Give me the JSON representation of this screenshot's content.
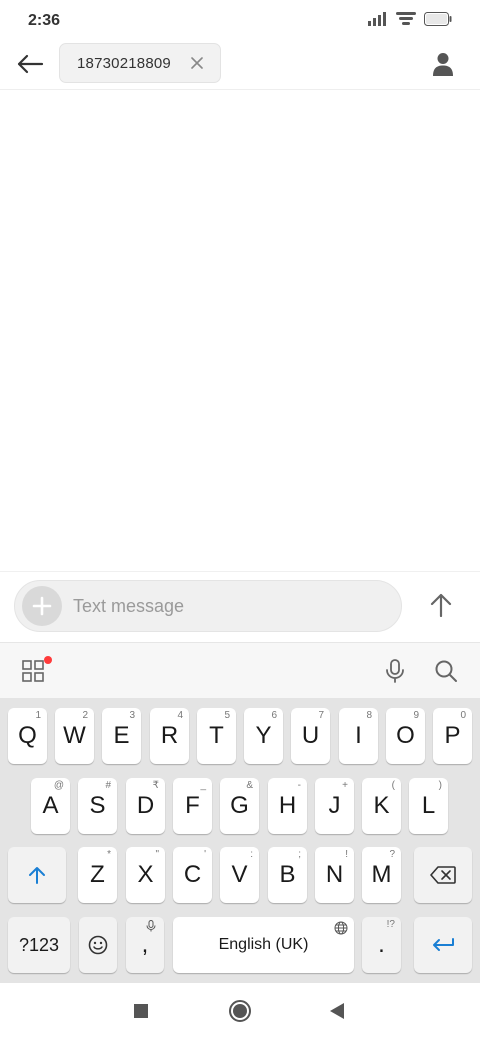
{
  "status_bar": {
    "time": "2:36",
    "icons": [
      "signal-icon",
      "wifi-icon",
      "battery-icon"
    ]
  },
  "header": {
    "back_icon": "arrow-left-icon",
    "recipient": "18730218809",
    "chip_close_icon": "close-icon",
    "contact_icon": "person-icon"
  },
  "compose": {
    "placeholder": "Text message",
    "attach_icon": "plus-icon",
    "send_icon": "arrow-up-icon"
  },
  "keyboard_toolbar": {
    "icons": [
      "apps-grid-icon",
      "mic-icon",
      "search-icon"
    ],
    "notification_color": "#ff3b3b"
  },
  "keyboard": {
    "row1": [
      {
        "label": "Q",
        "hint": "1"
      },
      {
        "label": "W",
        "hint": "2"
      },
      {
        "label": "E",
        "hint": "3"
      },
      {
        "label": "R",
        "hint": "4"
      },
      {
        "label": "T",
        "hint": "5"
      },
      {
        "label": "Y",
        "hint": "6"
      },
      {
        "label": "U",
        "hint": "7"
      },
      {
        "label": "I",
        "hint": "8"
      },
      {
        "label": "O",
        "hint": "9"
      },
      {
        "label": "P",
        "hint": "0"
      }
    ],
    "row2": [
      {
        "label": "A",
        "hint": "@"
      },
      {
        "label": "S",
        "hint": "#"
      },
      {
        "label": "D",
        "hint": "₹"
      },
      {
        "label": "F",
        "hint": "_"
      },
      {
        "label": "G",
        "hint": "&"
      },
      {
        "label": "H",
        "hint": "-"
      },
      {
        "label": "J",
        "hint": "+"
      },
      {
        "label": "K",
        "hint": "("
      },
      {
        "label": "L",
        "hint": ")"
      }
    ],
    "row3": [
      {
        "label": "Z",
        "hint": "*"
      },
      {
        "label": "X",
        "hint": "\""
      },
      {
        "label": "C",
        "hint": "'"
      },
      {
        "label": "V",
        "hint": ":"
      },
      {
        "label": "B",
        "hint": ";"
      },
      {
        "label": "N",
        "hint": "!"
      },
      {
        "label": "M",
        "hint": "?"
      }
    ],
    "symbols_label": "?123",
    "comma_label": ",",
    "space_label": "English (UK)",
    "period_label": ".",
    "period_hint": "!?",
    "accent_color": "#1a7fd4"
  }
}
